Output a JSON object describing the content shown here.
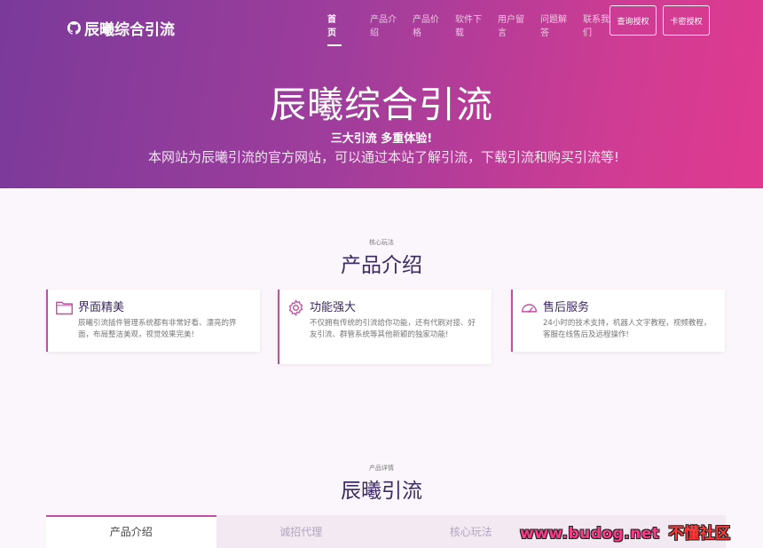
{
  "header": {
    "logo_text": "辰曦综合引流",
    "nav": [
      {
        "label": "首页",
        "active": true
      },
      {
        "label": "产品介绍",
        "active": false
      },
      {
        "label": "产品价格",
        "active": false
      },
      {
        "label": "软件下载",
        "active": false
      },
      {
        "label": "用户留言",
        "active": false
      },
      {
        "label": "问题解答",
        "active": false
      },
      {
        "label": "联系我们",
        "active": false
      }
    ],
    "btn_query": "查询授权",
    "btn_card": "卡密授权"
  },
  "hero": {
    "title": "辰曦综合引流",
    "subtitle": "三大引流 多重体验!",
    "description": "本网站为辰曦引流的官方网站，可以通过本站了解引流，下载引流和购买引流等!"
  },
  "intro": {
    "small": "核心玩法",
    "title": "产品介绍",
    "cards": [
      {
        "icon": "folder-icon",
        "title": "界面精美",
        "desc": "辰曦引流插件管理系统都有非常好看、漂亮的界面，布局整洁美观，视觉效果完美!"
      },
      {
        "icon": "gear-icon",
        "title": "功能强大",
        "desc": "不仅拥有传统的引流给你功能，还有代刷对接、好友引流、群管系统等其他新颖的独家功能!"
      },
      {
        "icon": "gauge-icon",
        "title": "售后服务",
        "desc": "24小时的技术支持，机器人文字教程，视频教程，客服在线售后及远程操作!"
      }
    ]
  },
  "detail": {
    "small": "产品详情",
    "title": "辰曦引流",
    "tabs": [
      {
        "label": "产品介绍",
        "active": true
      },
      {
        "label": "诚招代理",
        "active": false
      },
      {
        "label": "核心玩法",
        "active": false
      },
      {
        "label": "",
        "active": false
      }
    ]
  },
  "watermark": {
    "text1": "www.budog.net",
    "text2": "不懂社区"
  },
  "colors": {
    "accent": "#c34ea3",
    "heading": "#3c2a62"
  }
}
